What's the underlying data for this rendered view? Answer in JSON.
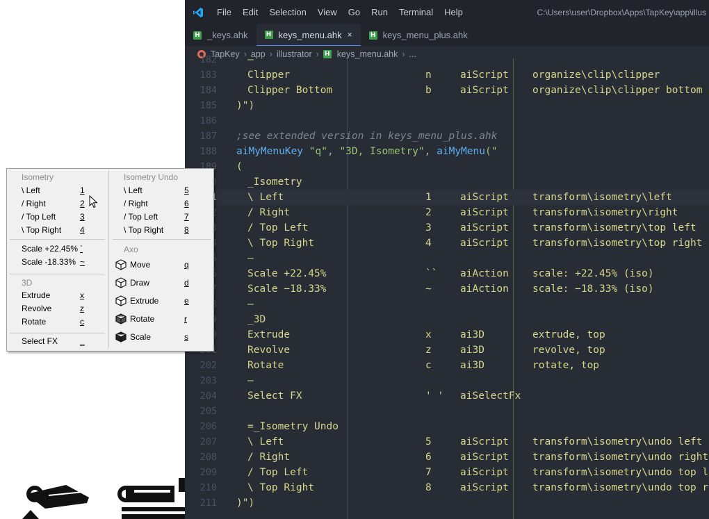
{
  "titlebar": {
    "menu": [
      "File",
      "Edit",
      "Selection",
      "View",
      "Go",
      "Run",
      "Terminal",
      "Help"
    ],
    "path": "C:\\Users\\user\\Dropbox\\Apps\\TapKey\\app\\illus"
  },
  "tabs": [
    {
      "label": "_keys.ahk",
      "icon": "H"
    },
    {
      "label": "keys_menu.ahk",
      "icon": "H",
      "close": "×"
    },
    {
      "label": "keys_menu_plus.ahk",
      "icon": "H"
    }
  ],
  "breadcrumb": {
    "items": [
      "TapKey",
      "app",
      "illustrator",
      "keys_menu.ahk",
      "..."
    ],
    "file_icon": "H"
  },
  "editor": {
    "lines": [
      {
        "num": "182",
        "cols": [
          "–"
        ]
      },
      {
        "num": "183",
        "cols": [
          "Clipper",
          "n",
          "aiScript",
          "organize\\clip\\clipper"
        ]
      },
      {
        "num": "184",
        "cols": [
          "Clipper Bottom",
          "b",
          "aiScript",
          "organize\\clip\\clipper bottom"
        ]
      },
      {
        "num": "185",
        "raw": ")\")"
      },
      {
        "num": "186",
        "raw": ""
      },
      {
        "num": "187",
        "comment": ";see extended version in keys_menu_plus.ahk"
      },
      {
        "num": "188",
        "call": {
          "fn1": "aiMyMenuKey",
          "s1": "\"q\"",
          "sep": ", ",
          "s2": "\"3D, Isometry\"",
          "sep2": ", ",
          "fn2": "aiMyMenu",
          "tail": "(\""
        }
      },
      {
        "num": "189",
        "raw": "("
      },
      {
        "num": "190",
        "cols": [
          "_Isometry"
        ]
      },
      {
        "num": "191",
        "cols": [
          "\\ Left",
          "1",
          "aiScript",
          "transform\\isometry\\left"
        ],
        "current": true
      },
      {
        "num": "192",
        "cols": [
          "/ Right",
          "2",
          "aiScript",
          "transform\\isometry\\right"
        ]
      },
      {
        "num": "193",
        "cols": [
          "/ Top Left",
          "3",
          "aiScript",
          "transform\\isometry\\top left"
        ]
      },
      {
        "num": "194",
        "cols": [
          "\\ Top Right",
          "4",
          "aiScript",
          "transform\\isometry\\top right"
        ]
      },
      {
        "num": "195",
        "cols": [
          "–"
        ]
      },
      {
        "num": "196",
        "cols": [
          "Scale +22.45%",
          "``",
          "aiAction",
          "scale: +22.45% (iso)"
        ]
      },
      {
        "num": "197",
        "cols": [
          "Scale −18.33%",
          "~",
          "aiAction",
          "scale: −18.33% (iso)"
        ]
      },
      {
        "num": "198",
        "cols": [
          "–"
        ]
      },
      {
        "num": "199",
        "cols": [
          "_3D"
        ]
      },
      {
        "num": "200",
        "cols": [
          "Extrude",
          "x",
          "ai3D",
          "extrude, top"
        ]
      },
      {
        "num": "201",
        "cols": [
          "Revolve",
          "z",
          "ai3D",
          "revolve, top"
        ]
      },
      {
        "num": "202",
        "cols": [
          "Rotate",
          "c",
          "ai3D",
          "rotate, top"
        ]
      },
      {
        "num": "203",
        "cols": [
          "–"
        ]
      },
      {
        "num": "204",
        "cols": [
          "Select FX",
          "' '",
          "aiSelectFx"
        ]
      },
      {
        "num": "205",
        "raw": ""
      },
      {
        "num": "206",
        "cols": [
          "=_Isometry Undo"
        ]
      },
      {
        "num": "207",
        "cols": [
          "\\ Left",
          "5",
          "aiScript",
          "transform\\isometry\\undo left"
        ]
      },
      {
        "num": "208",
        "cols": [
          "/ Right",
          "6",
          "aiScript",
          "transform\\isometry\\undo right"
        ]
      },
      {
        "num": "209",
        "cols": [
          "/ Top Left",
          "7",
          "aiScript",
          "transform\\isometry\\undo top left"
        ]
      },
      {
        "num": "210",
        "cols": [
          "\\ Top Right",
          "8",
          "aiScript",
          "transform\\isometry\\undo top right"
        ]
      },
      {
        "num": "211",
        "raw": ")\")"
      }
    ]
  },
  "popup": {
    "left": {
      "header1": "Isometry",
      "items1": [
        {
          "label": "\\ Left",
          "key": "1"
        },
        {
          "label": "/ Right",
          "key": "2"
        },
        {
          "label": "/ Top Left",
          "key": "3"
        },
        {
          "label": "\\ Top Right",
          "key": "4"
        }
      ],
      "items2": [
        {
          "label": "Scale +22.45%",
          "key": "`"
        },
        {
          "label": "Scale -18.33%",
          "key": "~"
        }
      ],
      "header3": "3D",
      "items3": [
        {
          "label": "Extrude",
          "key": "x"
        },
        {
          "label": "Revolve",
          "key": "z"
        },
        {
          "label": "Rotate",
          "key": "c"
        }
      ],
      "items4": [
        {
          "label": "Select FX",
          "key": "_"
        }
      ]
    },
    "right": {
      "header1": "Isometry Undo",
      "items1": [
        {
          "label": "\\ Left",
          "key": "5"
        },
        {
          "label": "/ Right",
          "key": "6"
        },
        {
          "label": "/ Top Left",
          "key": "7"
        },
        {
          "label": "\\ Top Right",
          "key": "8"
        }
      ],
      "header2": "Axo",
      "items2": [
        {
          "label": "Move",
          "key": "q",
          "icon": "move-cube-icon"
        },
        {
          "label": "Draw",
          "key": "d",
          "icon": "draw-cube-icon"
        },
        {
          "label": "Extrude",
          "key": "e",
          "icon": "extrude-cube-icon"
        },
        {
          "label": "Rotate",
          "key": "r",
          "icon": "rotate-cube-icon"
        },
        {
          "label": "Scale",
          "key": "s",
          "icon": "scale-cube-icon"
        }
      ]
    }
  },
  "colors": {
    "editor_bg": "#282c34",
    "titlebar_bg": "#21252b",
    "code_text": "#d7d78e",
    "comment": "#7f848e",
    "string": "#98c379",
    "function": "#61afef",
    "vscode_blue": "#23a9f2"
  }
}
